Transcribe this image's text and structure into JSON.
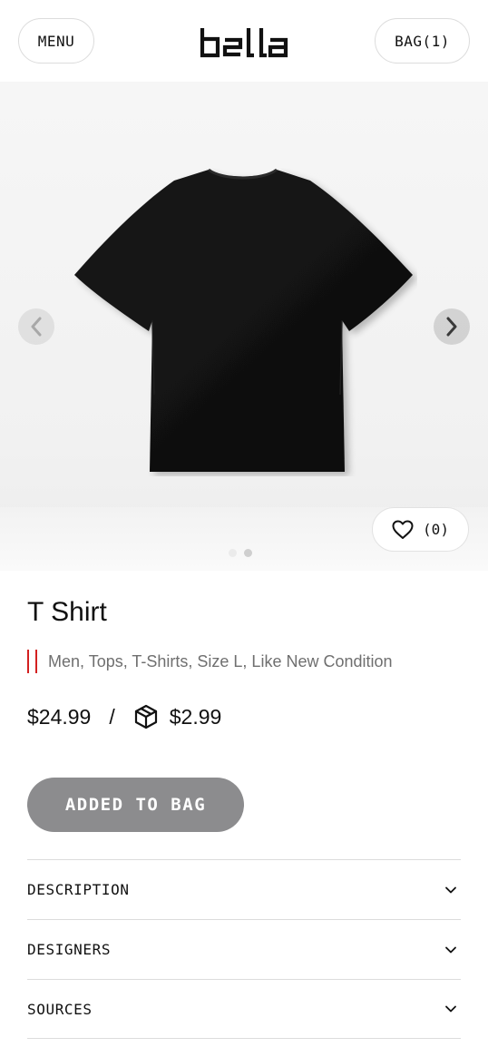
{
  "header": {
    "menu_label": "MENU",
    "logo_text": "bella",
    "bag_label": "BAG(1)"
  },
  "gallery": {
    "image_subject": "black t-shirt",
    "slide_count": 2,
    "active_slide": 2,
    "like_count": "(0)",
    "icons": {
      "prev": "chevron-left-icon",
      "next": "chevron-right-icon",
      "like": "heart-icon"
    }
  },
  "product": {
    "title": "T Shirt",
    "tags": "Men, Tops, T-Shirts, Size L, Like New Condition",
    "price": "$24.99",
    "separator": "/",
    "shipping_price": "$2.99",
    "shipping_icon": "package-box-icon",
    "add_button_label": "ADDED TO BAG"
  },
  "accordion": {
    "items": [
      {
        "label": "DESCRIPTION"
      },
      {
        "label": "DESIGNERS"
      },
      {
        "label": "SOURCES"
      }
    ]
  },
  "colors": {
    "tag_marker": "#d32020",
    "added_button_bg": "#8c8c8e",
    "text_primary": "#111111",
    "text_muted": "#6f6f6f"
  }
}
